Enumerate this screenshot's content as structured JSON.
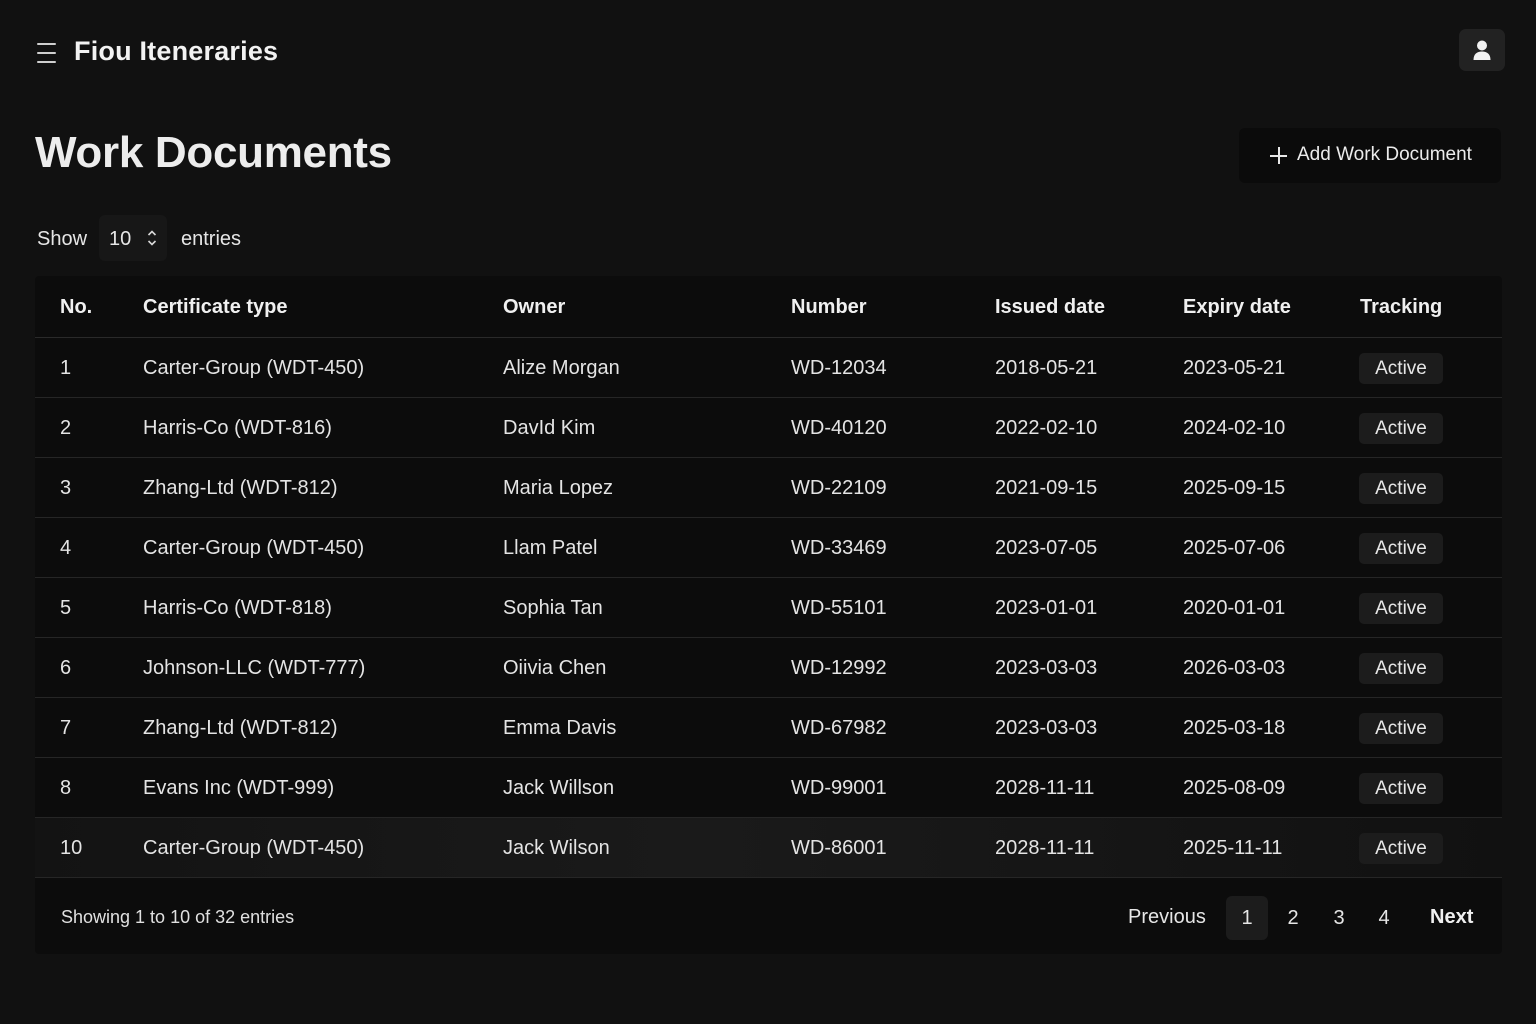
{
  "app": {
    "title": "Fiou Iteneraries"
  },
  "header": {
    "title": "Work Documents",
    "add_button": "Add Work Document"
  },
  "entries": {
    "show_label": "Show",
    "value": "10",
    "suffix": "entries"
  },
  "table": {
    "columns": [
      "No.",
      "Certificate type",
      "Owner",
      "Number",
      "Issued date",
      "Expiry date",
      "Tracking"
    ],
    "rows": [
      {
        "no": "1",
        "type": "Carter-Group (WDT-450)",
        "owner": "Alize Morgan",
        "number": "WD-12034",
        "issued": "2018-05-21",
        "expiry": "2023-05-21",
        "tracking": "Active"
      },
      {
        "no": "2",
        "type": "Harris-Co (WDT-816)",
        "owner": "DavId Kim",
        "number": "WD-40120",
        "issued": "2022-02-10",
        "expiry": "2024-02-10",
        "tracking": "Active"
      },
      {
        "no": "3",
        "type": "Zhang-Ltd (WDT-812)",
        "owner": "Maria Lopez",
        "number": "WD-22109",
        "issued": "2021-09-15",
        "expiry": "2025-09-15",
        "tracking": "Active"
      },
      {
        "no": "4",
        "type": "Carter-Group (WDT-450)",
        "owner": "Llam Patel",
        "number": "WD-33469",
        "issued": "2023-07-05",
        "expiry": "2025-07-06",
        "tracking": "Active"
      },
      {
        "no": "5",
        "type": "Harris-Co (WDT-818)",
        "owner": "Sophia Tan",
        "number": "WD-55101",
        "issued": "2023-01-01",
        "expiry": "2020-01-01",
        "tracking": "Active"
      },
      {
        "no": "6",
        "type": "Johnson-LLC (WDT-777)",
        "owner": "Oiivia Chen",
        "number": "WD-12992",
        "issued": "2023-03-03",
        "expiry": "2026-03-03",
        "tracking": "Active"
      },
      {
        "no": "7",
        "type": "Zhang-Ltd (WDT-812)",
        "owner": "Emma Davis",
        "number": "WD-67982",
        "issued": "2023-03-03",
        "expiry": "2025-03-18",
        "tracking": "Active"
      },
      {
        "no": "8",
        "type": "Evans Inc (WDT-999)",
        "owner": "Jack Willson",
        "number": "WD-99001",
        "issued": "2028-11-11",
        "expiry": "2025-08-09",
        "tracking": "Active"
      },
      {
        "no": "10",
        "type": "Carter-Group (WDT-450)",
        "owner": "Jack Wilson",
        "number": "WD-86001",
        "issued": "2028-11-11",
        "expiry": "2025-11-11",
        "tracking": "Active"
      }
    ]
  },
  "footer": {
    "summary": "Showing 1 to 10 of 32 entries",
    "previous": "Previous",
    "pages": [
      "1",
      "2",
      "3",
      "4"
    ],
    "next": "Next"
  }
}
